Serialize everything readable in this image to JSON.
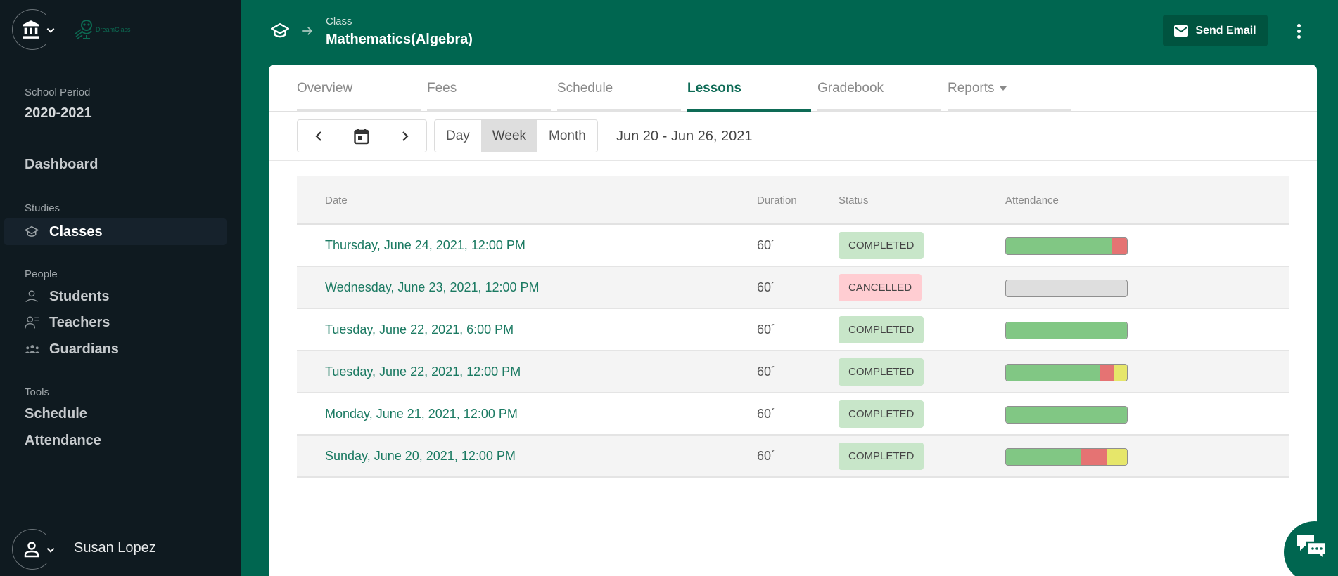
{
  "sidebar": {
    "logo_text": "DreamClass",
    "school_period_label": "School Period",
    "school_period_value": "2020-2021",
    "dashboard": "Dashboard",
    "studies_label": "Studies",
    "classes": "Classes",
    "people_label": "People",
    "students": "Students",
    "teachers": "Teachers",
    "guardians": "Guardians",
    "tools_label": "Tools",
    "schedule": "Schedule",
    "attendance": "Attendance",
    "user_name": "Susan Lopez"
  },
  "header": {
    "breadcrumb_label": "Class",
    "title": "Mathematics(Algebra)",
    "send_email": "Send Email"
  },
  "tabs": [
    {
      "label": "Overview"
    },
    {
      "label": "Fees"
    },
    {
      "label": "Schedule"
    },
    {
      "label": "Lessons",
      "active": true
    },
    {
      "label": "Gradebook"
    },
    {
      "label": "Reports",
      "dropdown": true
    }
  ],
  "toolbar": {
    "views": [
      "Day",
      "Week",
      "Month"
    ],
    "active_view": "Week",
    "date_range": "Jun 20 - Jun 26, 2021"
  },
  "table": {
    "columns": [
      "Date",
      "Duration",
      "Status",
      "Attendance"
    ],
    "rows": [
      {
        "date": "Thursday, June 24, 2021, 12:00 PM",
        "duration": "60´",
        "status": "COMPLETED",
        "attendance": {
          "present": 0.88,
          "absent": 0.12,
          "late": 0
        }
      },
      {
        "date": "Wednesday, June 23, 2021, 12:00 PM",
        "duration": "60´",
        "status": "CANCELLED",
        "attendance": {
          "present": 0,
          "absent": 0,
          "late": 0
        }
      },
      {
        "date": "Tuesday, June 22, 2021, 6:00 PM",
        "duration": "60´",
        "status": "COMPLETED",
        "attendance": {
          "present": 1.0,
          "absent": 0,
          "late": 0
        }
      },
      {
        "date": "Tuesday, June 22, 2021, 12:00 PM",
        "duration": "60´",
        "status": "COMPLETED",
        "attendance": {
          "present": 0.78,
          "absent": 0.11,
          "late": 0.11
        }
      },
      {
        "date": "Monday, June 21, 2021, 12:00 PM",
        "duration": "60´",
        "status": "COMPLETED",
        "attendance": {
          "present": 1.0,
          "absent": 0,
          "late": 0
        }
      },
      {
        "date": "Sunday, June 20, 2021, 12:00 PM",
        "duration": "60´",
        "status": "COMPLETED",
        "attendance": {
          "present": 0.62,
          "absent": 0.22,
          "late": 0.16
        }
      }
    ]
  },
  "colors": {
    "brand_green": "#006650",
    "link_green": "#1b7a62",
    "present": "#81c784",
    "absent": "#e57373",
    "late": "#e6e66a",
    "completed_bg": "#c8e6c9",
    "cancelled_bg": "#ffcdd2"
  }
}
